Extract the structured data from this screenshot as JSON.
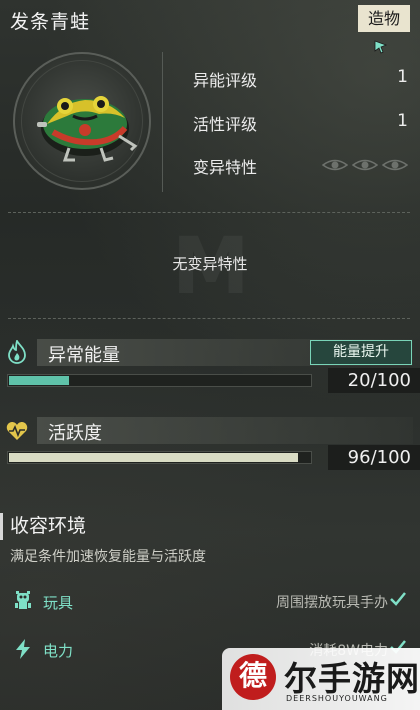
{
  "header": {
    "title": "发条青蛙",
    "category_tag": "造物"
  },
  "stats": {
    "ability_rating_label": "异能评级",
    "ability_rating_value": "1",
    "activity_rating_label": "活性评级",
    "activity_rating_value": "1",
    "mutation_label": "变异特性",
    "mutation_icons": [
      "eye-icon",
      "eye-icon",
      "eye-icon"
    ]
  },
  "traits": {
    "empty_text": "无变异特性"
  },
  "energy": {
    "label": "异常能量",
    "boost_button": "能量提升",
    "value_text": "20/100",
    "fraction": 0.2,
    "color": "#5fc2a9"
  },
  "vitality": {
    "label": "活跃度",
    "value_text": "96/100",
    "fraction": 0.96,
    "color": "#d9dcc4"
  },
  "containment": {
    "title": "收容环境",
    "description": "满足条件加速恢复能量与活跃度",
    "items": [
      {
        "name": "玩具",
        "condition": "周围摆放玩具手办",
        "icon": "toy-icon"
      },
      {
        "name": "电力",
        "condition": "消耗8W电力",
        "icon": "lightning-icon"
      }
    ]
  },
  "watermark": {
    "site_name": "尔手游网",
    "site_domain": "DEERSHOUYOUWANG",
    "logo_char": "德"
  },
  "colors": {
    "accent": "#7fe0c7",
    "tag_bg": "#e9e4cf"
  }
}
